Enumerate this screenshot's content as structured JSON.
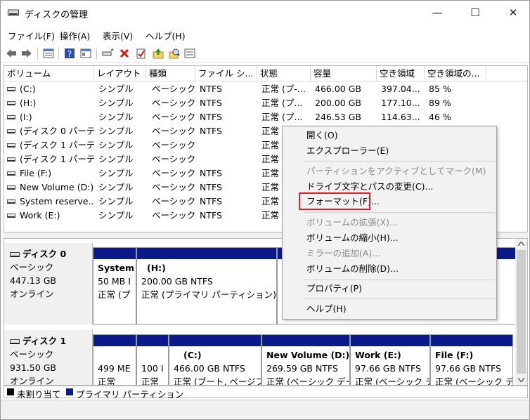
{
  "window": {
    "title": "ディスクの管理",
    "min": "—",
    "max": "☐",
    "close": "✕"
  },
  "menu": [
    "ファイル(F)",
    "操作(A)",
    "表示(V)",
    "ヘルプ(H)"
  ],
  "toolbar_icons": [
    "back-arrow-icon",
    "forward-arrow-icon",
    "list-view-icon",
    "help-icon",
    "properties-icon",
    "connect-icon",
    "delete-icon",
    "check-icon",
    "import-icon",
    "search-icon",
    "list-icon"
  ],
  "columns": [
    "ボリューム",
    "レイアウト",
    "種類",
    "ファイル シ...",
    "状態",
    "容量",
    "空き領域",
    "空き領域の..."
  ],
  "volumes": [
    {
      "name": "(C:)",
      "layout": "シンプル",
      "type": "ベーシック",
      "fs": "NTFS",
      "status": "正常 (ブ-...",
      "capacity": "466.00 GB",
      "free": "397.04...",
      "pct": "85 %"
    },
    {
      "name": "(H:)",
      "layout": "シンプル",
      "type": "ベーシック",
      "fs": "NTFS",
      "status": "正常 (プ...",
      "capacity": "200.00 GB",
      "free": "177.10...",
      "pct": "89 %"
    },
    {
      "name": "(I:)",
      "layout": "シンプル",
      "type": "ベーシック",
      "fs": "NTFS",
      "status": "正常 (プ...",
      "capacity": "246.53 GB",
      "free": "114.63...",
      "pct": "46 %"
    },
    {
      "name": "(ディスク 0 パーテ...",
      "layout": "シンプル",
      "type": "ベーシック",
      "fs": "NTFS",
      "status": "正常",
      "capacity": "",
      "free": "",
      "pct": ""
    },
    {
      "name": "(ディスク 1 パーテ...",
      "layout": "シンプル",
      "type": "ベーシック",
      "fs": "",
      "status": "正常",
      "capacity": "",
      "free": "",
      "pct": ""
    },
    {
      "name": "(ディスク 1 パーテ...",
      "layout": "シンプル",
      "type": "ベーシック",
      "fs": "",
      "status": "正常",
      "capacity": "",
      "free": "",
      "pct": ""
    },
    {
      "name": "File (F:)",
      "layout": "シンプル",
      "type": "ベーシック",
      "fs": "NTFS",
      "status": "正常",
      "capacity": "",
      "free": "",
      "pct": ""
    },
    {
      "name": "New Volume (D:)",
      "layout": "シンプル",
      "type": "ベーシック",
      "fs": "NTFS",
      "status": "正常",
      "capacity": "",
      "free": "",
      "pct": ""
    },
    {
      "name": "System reserve...",
      "layout": "シンプル",
      "type": "ベーシック",
      "fs": "NTFS",
      "status": "正常",
      "capacity": "",
      "free": "",
      "pct": ""
    },
    {
      "name": "Work (E:)",
      "layout": "シンプル",
      "type": "ベーシック",
      "fs": "NTFS",
      "status": "正常",
      "capacity": "",
      "free": "",
      "pct": ""
    }
  ],
  "disks": [
    {
      "name": "ディスク 0",
      "type": "ベーシック",
      "size": "447.13 GB",
      "state": "オンライン",
      "parts": [
        {
          "name": "System",
          "size": "50 MB I",
          "status": "正常 (プ"
        },
        {
          "name": "(H:)",
          "size": "200.00 GB NTFS",
          "status": "正常 (プライマリ パーティション)"
        }
      ]
    },
    {
      "name": "ディスク 1",
      "type": "ベーシック",
      "size": "931.50 GB",
      "state": "オンライン",
      "parts": [
        {
          "name": "",
          "size": "499 ME",
          "status": "正常"
        },
        {
          "name": "",
          "size": "100 I",
          "status": "正常"
        },
        {
          "name": "(C:)",
          "size": "466.00 GB NTFS",
          "status": "正常 (ブート, ページフ"
        },
        {
          "name": "New Volume (D:)",
          "size": "269.59 GB NTFS",
          "status": "正常 (ベーシック デー"
        },
        {
          "name": "Work (E:)",
          "size": "97.66 GB NTFS",
          "status": "正常 (ベーシック デ"
        },
        {
          "name": "File (F:)",
          "size": "97.66 GB NTFS",
          "status": "正常 (ベーシック デ"
        }
      ]
    }
  ],
  "legend": {
    "unallocated": "未割り当て",
    "primary": "プライマリ パーティション"
  },
  "context_menu": [
    {
      "label": "開く(O)",
      "disabled": false
    },
    {
      "label": "エクスプローラー(E)",
      "disabled": false
    },
    {
      "label": "パーティションをアクティブとしてマーク(M)",
      "disabled": true
    },
    {
      "label": "ドライブ文字とパスの変更(C)...",
      "disabled": false
    },
    {
      "label": "フォーマット(F)...",
      "disabled": false
    },
    {
      "label": "ボリュームの拡張(X)...",
      "disabled": true
    },
    {
      "label": "ボリュームの縮小(H)...",
      "disabled": false
    },
    {
      "label": "ミラーの追加(A)...",
      "disabled": true
    },
    {
      "label": "ボリュームの削除(D)...",
      "disabled": false
    },
    {
      "label": "プロパティ(P)",
      "disabled": false
    },
    {
      "label": "ヘルプ(H)",
      "disabled": false
    }
  ],
  "colors": {
    "primary_partition": "#0a1a88",
    "unallocated": "#000000",
    "highlight": "#e0202a"
  }
}
